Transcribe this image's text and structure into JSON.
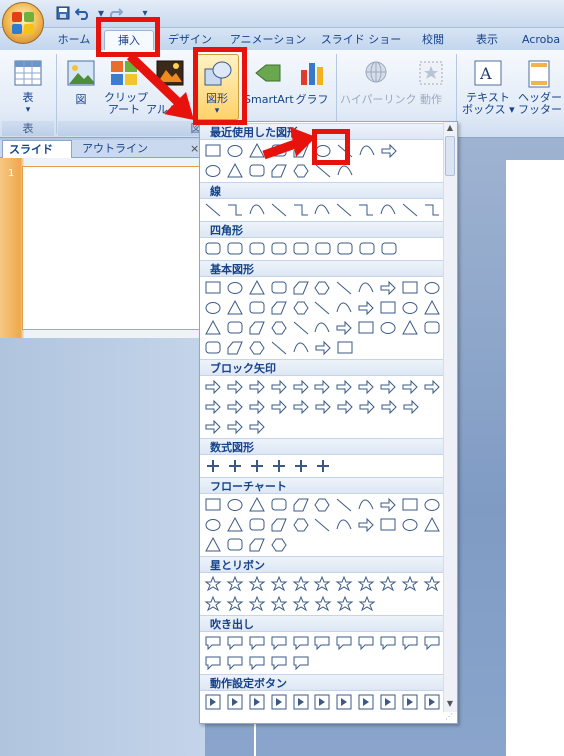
{
  "quick_access": {
    "save_icon": "save-icon",
    "undo_icon": "undo-icon",
    "redo_icon": "redo-icon",
    "customize_glyph": "▾"
  },
  "tabs": [
    {
      "label": "ホーム"
    },
    {
      "label": "挿入",
      "active": true
    },
    {
      "label": "デザイン"
    },
    {
      "label": "アニメーション"
    },
    {
      "label": "スライド ショー"
    },
    {
      "label": "校閲"
    },
    {
      "label": "表示"
    },
    {
      "label": "Acroba"
    }
  ],
  "ribbon": {
    "table": {
      "label": "表",
      "group_label": "表"
    },
    "picture": {
      "label": "図"
    },
    "clipart": {
      "label_line1": "クリップ",
      "label_line2": "アート"
    },
    "album": {
      "label": "アルバム"
    },
    "shapes": {
      "label": "図形",
      "dropdown_glyph": "▾"
    },
    "smartart": {
      "label": "SmartArt"
    },
    "graph": {
      "label": "グラフ"
    },
    "hyperlink": {
      "label": "ハイパーリンク"
    },
    "action": {
      "label": "動作"
    },
    "textbox": {
      "label_line1": "テキスト",
      "label_line2": "ボックス ▾"
    },
    "header_footer": {
      "label_line1": "ヘッダーと",
      "label_line2": "フッター"
    },
    "illustration_group_label": "図"
  },
  "left_pane": {
    "tab_slides": "スライド",
    "tab_outline": "アウトライン",
    "close_glyph": "×",
    "slide_number": "1"
  },
  "dropdown": {
    "sections": [
      {
        "title": "最近使用した図形",
        "rows": [
          9,
          7
        ]
      },
      {
        "title": "線",
        "rows": [
          11
        ]
      },
      {
        "title": "四角形",
        "rows": [
          9
        ]
      },
      {
        "title": "基本図形",
        "rows": [
          11,
          11,
          11,
          7
        ]
      },
      {
        "title": "ブロック矢印",
        "rows": [
          11,
          10,
          3
        ]
      },
      {
        "title": "数式図形",
        "rows": [
          6
        ]
      },
      {
        "title": "フローチャート",
        "rows": [
          11,
          11,
          4
        ]
      },
      {
        "title": "星とリボン",
        "rows": [
          11,
          8
        ]
      },
      {
        "title": "吹き出し",
        "rows": [
          11,
          5
        ]
      },
      {
        "title": "動作設定ボタン",
        "rows": [
          11
        ]
      }
    ],
    "scroll_up": "▲",
    "scroll_down": "▼"
  },
  "colors": {
    "accent": "#15428b",
    "highlight": "#e8120c",
    "shape_stroke": "#3a5a85"
  }
}
